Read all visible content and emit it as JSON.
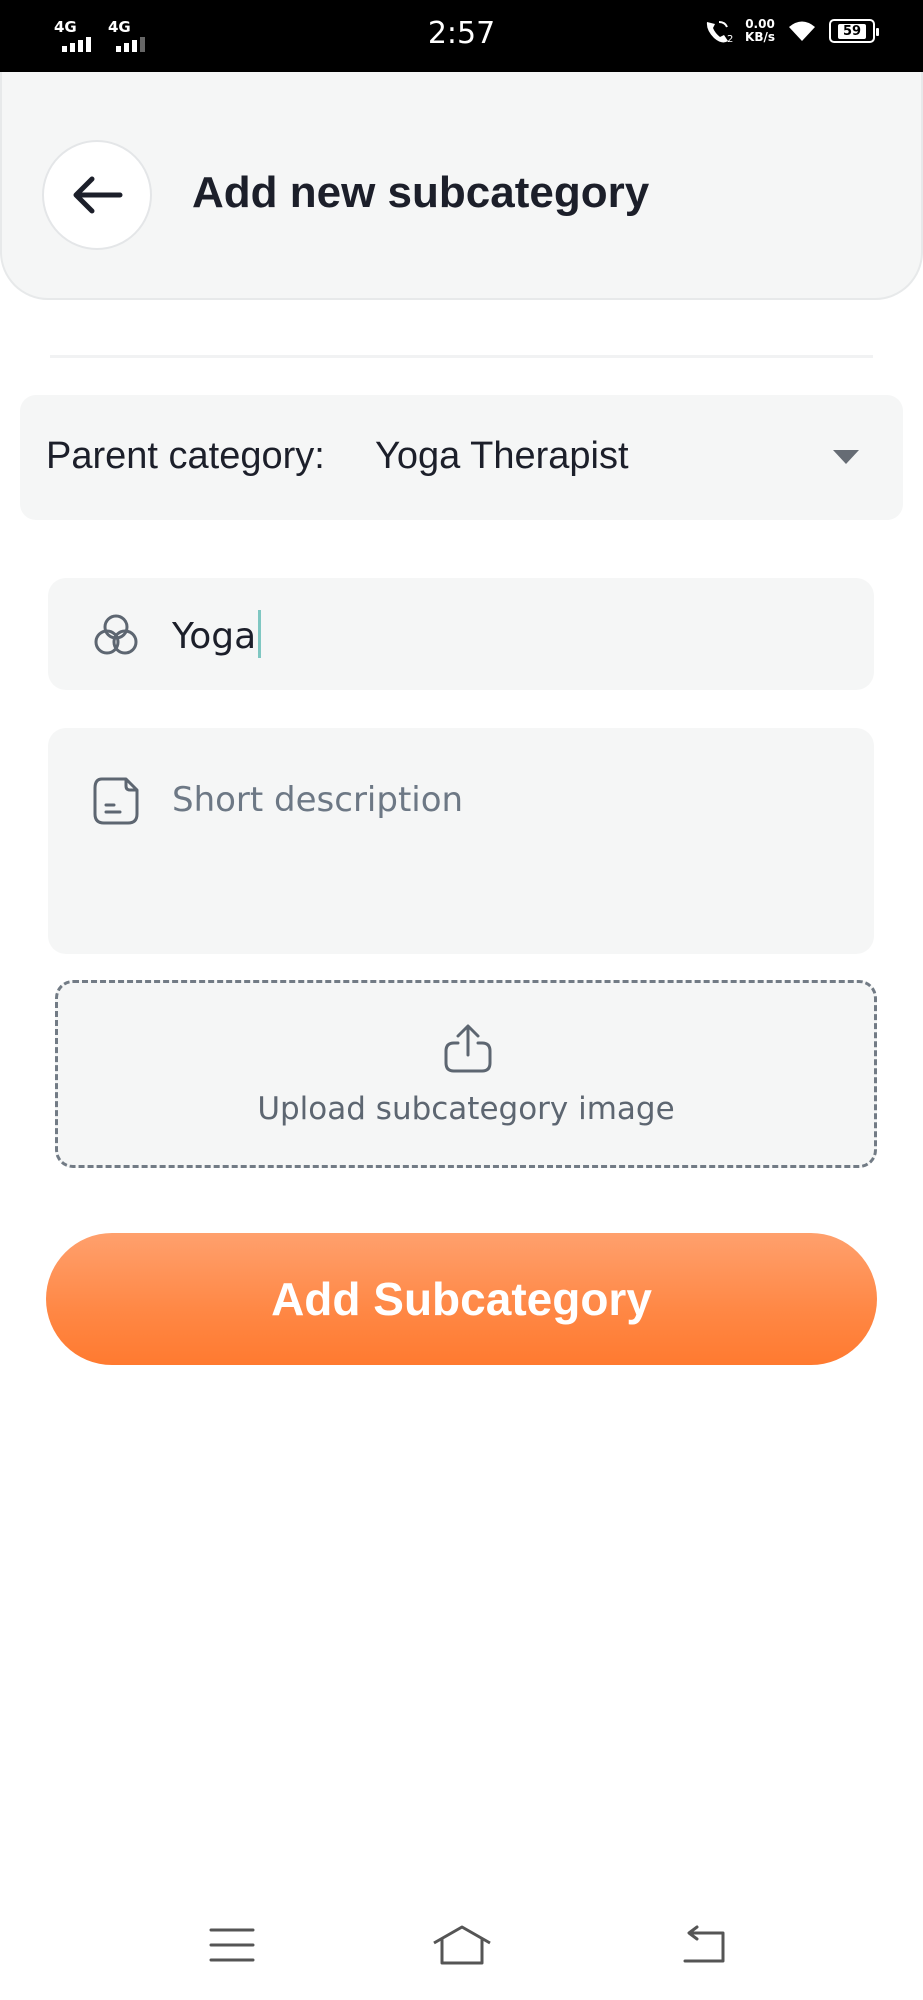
{
  "status_bar": {
    "time": "2:57",
    "sim1": "4G",
    "sim2": "4G",
    "speed_value": "0.00",
    "speed_unit": "KB/s",
    "battery": "59"
  },
  "header": {
    "title": "Add new subcategory",
    "back_icon": "arrow-left-icon"
  },
  "parent_category": {
    "label": "Parent category:",
    "value": "Yoga Therapist"
  },
  "form": {
    "name_value": "Yoga",
    "name_icon": "circles-icon",
    "description_placeholder": "Short description",
    "description_icon": "note-icon",
    "upload_label": "Upload subcategory image",
    "upload_icon": "upload-icon"
  },
  "actions": {
    "submit_label": "Add Subcategory"
  },
  "colors": {
    "accent": "#ff8744",
    "field_bg": "#f5f6f6",
    "cursor": "#7fc7c2"
  }
}
